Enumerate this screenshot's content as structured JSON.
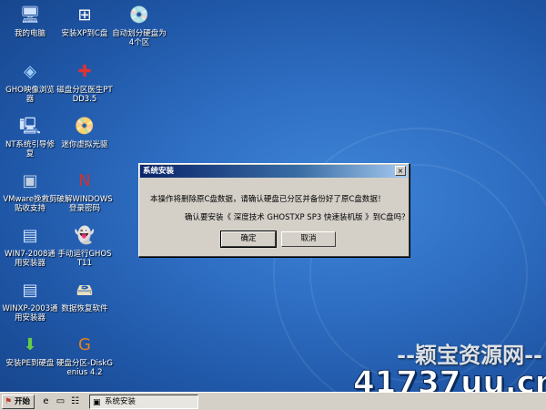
{
  "desktop": {
    "icons": [
      {
        "label": "我的电脑",
        "glyph": "🖥"
      },
      {
        "label": "安装XP到C盘",
        "glyph": "⊞"
      },
      {
        "label": "自动划分硬盘为4个区",
        "glyph": "💿"
      },
      {
        "label": "GHO映像浏览器",
        "glyph": "◈"
      },
      {
        "label": "磁盘分区医生PTDD3.5",
        "glyph": "✚"
      },
      {
        "label": "NT系统引导修复",
        "glyph": "🖳"
      },
      {
        "label": "迷你虚拟光驱",
        "glyph": "📀"
      },
      {
        "label": "VMware挽救剪贴收支持",
        "glyph": "▣"
      },
      {
        "label": "破解WINDOWS登录密码",
        "glyph": "N"
      },
      {
        "label": "WIN7-2008通用安装器",
        "glyph": "▤"
      },
      {
        "label": "手动运行GHOST11",
        "glyph": "👻"
      },
      {
        "label": "WINXP-2003通用安装器",
        "glyph": "▤"
      },
      {
        "label": "数据恢复软件",
        "glyph": "🖴"
      },
      {
        "label": "安装PE到硬盘",
        "glyph": "⬇"
      },
      {
        "label": "硬盘分区-DiskGenius 4.2",
        "glyph": "G"
      }
    ]
  },
  "dialog": {
    "title": "系统安装",
    "close_glyph": "×",
    "message_line1": "本操作将删除原C盘数据，请确认硬盘已分区并备份好了原C盘数据！",
    "message_line2": "确认要安装《 深度技术 GHOSTXP SP3 快速装机版 》到C盘吗？",
    "ok_label": "确定",
    "cancel_label": "取消"
  },
  "taskbar": {
    "start_label": "开始",
    "task_label": "系统安装"
  },
  "watermark": {
    "line1": "--颖宝资源网--",
    "line2": "41737uu.cn"
  },
  "colors": {
    "desktop_blue": "#2f6fc4",
    "title_bar": "#0a246a",
    "dialog_face": "#d4d0c8"
  }
}
